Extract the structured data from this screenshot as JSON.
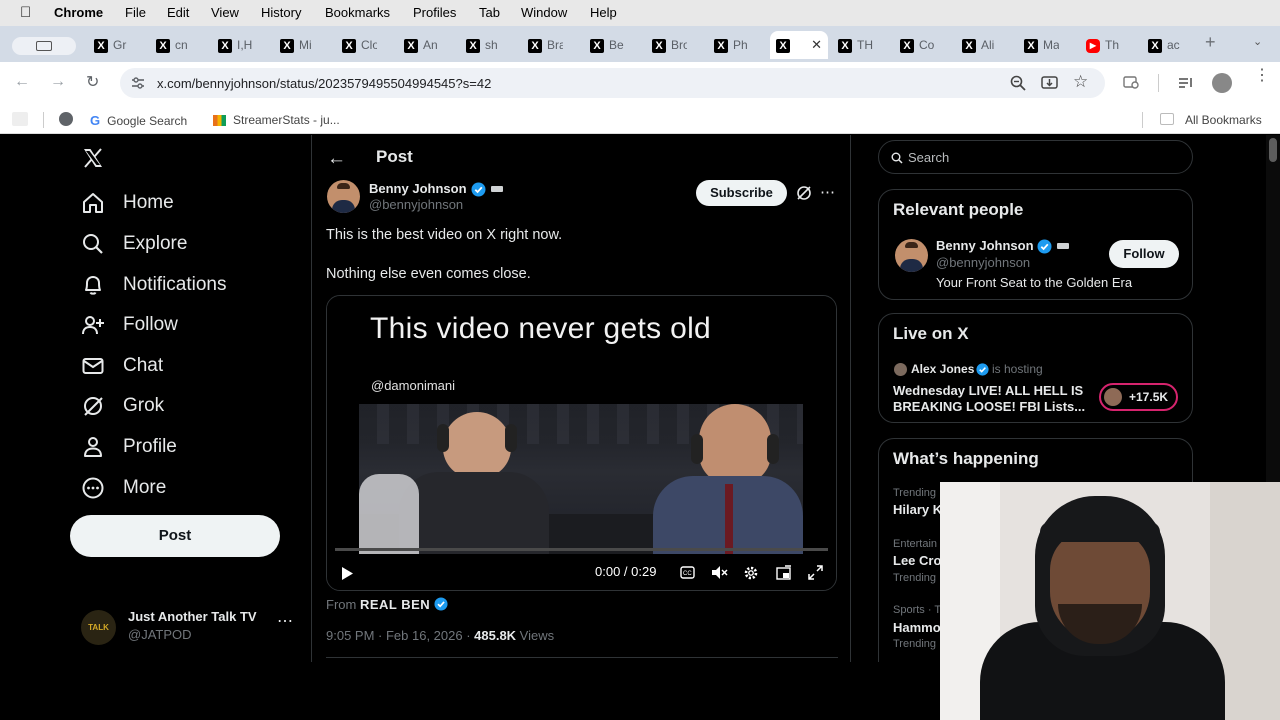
{
  "menubar": {
    "app": "Chrome",
    "items": [
      "File",
      "Edit",
      "View",
      "History",
      "Bookmarks",
      "Profiles",
      "Tab",
      "Window",
      "Help"
    ]
  },
  "tabs": [
    {
      "label": "Gr"
    },
    {
      "label": "cn"
    },
    {
      "label": "I,H"
    },
    {
      "label": "Mi"
    },
    {
      "label": "Clo"
    },
    {
      "label": "An"
    },
    {
      "label": "sh"
    },
    {
      "label": "Bra"
    },
    {
      "label": "Be"
    },
    {
      "label": "Bro"
    },
    {
      "label": "Ph"
    },
    {
      "label": "",
      "active": true
    },
    {
      "label": "TH"
    },
    {
      "label": "Co"
    },
    {
      "label": "Ali"
    },
    {
      "label": "Ma"
    },
    {
      "label": "Th"
    },
    {
      "label": "ac"
    }
  ],
  "toolbar": {
    "url": "x.com/bennyjohnson/status/2023579495504994545?s=42"
  },
  "bookmarks": {
    "items": [
      "Google Search",
      "StreamerStats - ju..."
    ],
    "all": "All Bookmarks"
  },
  "sidebar": {
    "nav": [
      "Home",
      "Explore",
      "Notifications",
      "Follow",
      "Chat",
      "Grok",
      "Profile",
      "More"
    ],
    "post_button": "Post",
    "account": {
      "name": "Just Another Talk TV",
      "handle": "@JATPOD",
      "avatar_text": "TALK"
    }
  },
  "post": {
    "header": "Post",
    "author": {
      "name": "Benny Johnson",
      "handle": "@bennyjohnson"
    },
    "subscribe": "Subscribe",
    "text1": "This is the best video on X right now.",
    "text2": "Nothing else even comes close.",
    "video": {
      "caption": "This video never gets old",
      "watermark": "@damonimani",
      "time": "0:00 / 0:29",
      "progress": 0
    },
    "from_label": "From",
    "from_name": "REAL BEN",
    "timestamp": "9:05 PM · Feb 16, 2026 · ",
    "views_count": "485.8K",
    "views_label": " Views"
  },
  "right": {
    "search_placeholder": "Search",
    "relevant": {
      "title": "Relevant people",
      "name": "Benny Johnson",
      "handle": "@bennyjohnson",
      "bio": "Your Front Seat to the Golden Era",
      "follow": "Follow"
    },
    "live": {
      "title": "Live on X",
      "host": "Alex Jones",
      "hosting": "is hosting",
      "headline1": "Wednesday LIVE! ALL HELL IS",
      "headline2": "BREAKING LOOSE! FBI Lists...",
      "count": "+17.5K"
    },
    "happening": {
      "title": "What’s happening",
      "items": [
        {
          "meta": "Trending",
          "topic": "Hilary K"
        },
        {
          "meta": "Entertain",
          "topic": "Lee Cro",
          "sub": "Trending"
        },
        {
          "meta": "Sports · T",
          "topic": "Hammo",
          "sub": "Trending"
        }
      ]
    }
  },
  "colors": {
    "accent": "#1d9bf0",
    "bg": "#000000",
    "border": "#2f3336",
    "muted": "#71767b"
  }
}
